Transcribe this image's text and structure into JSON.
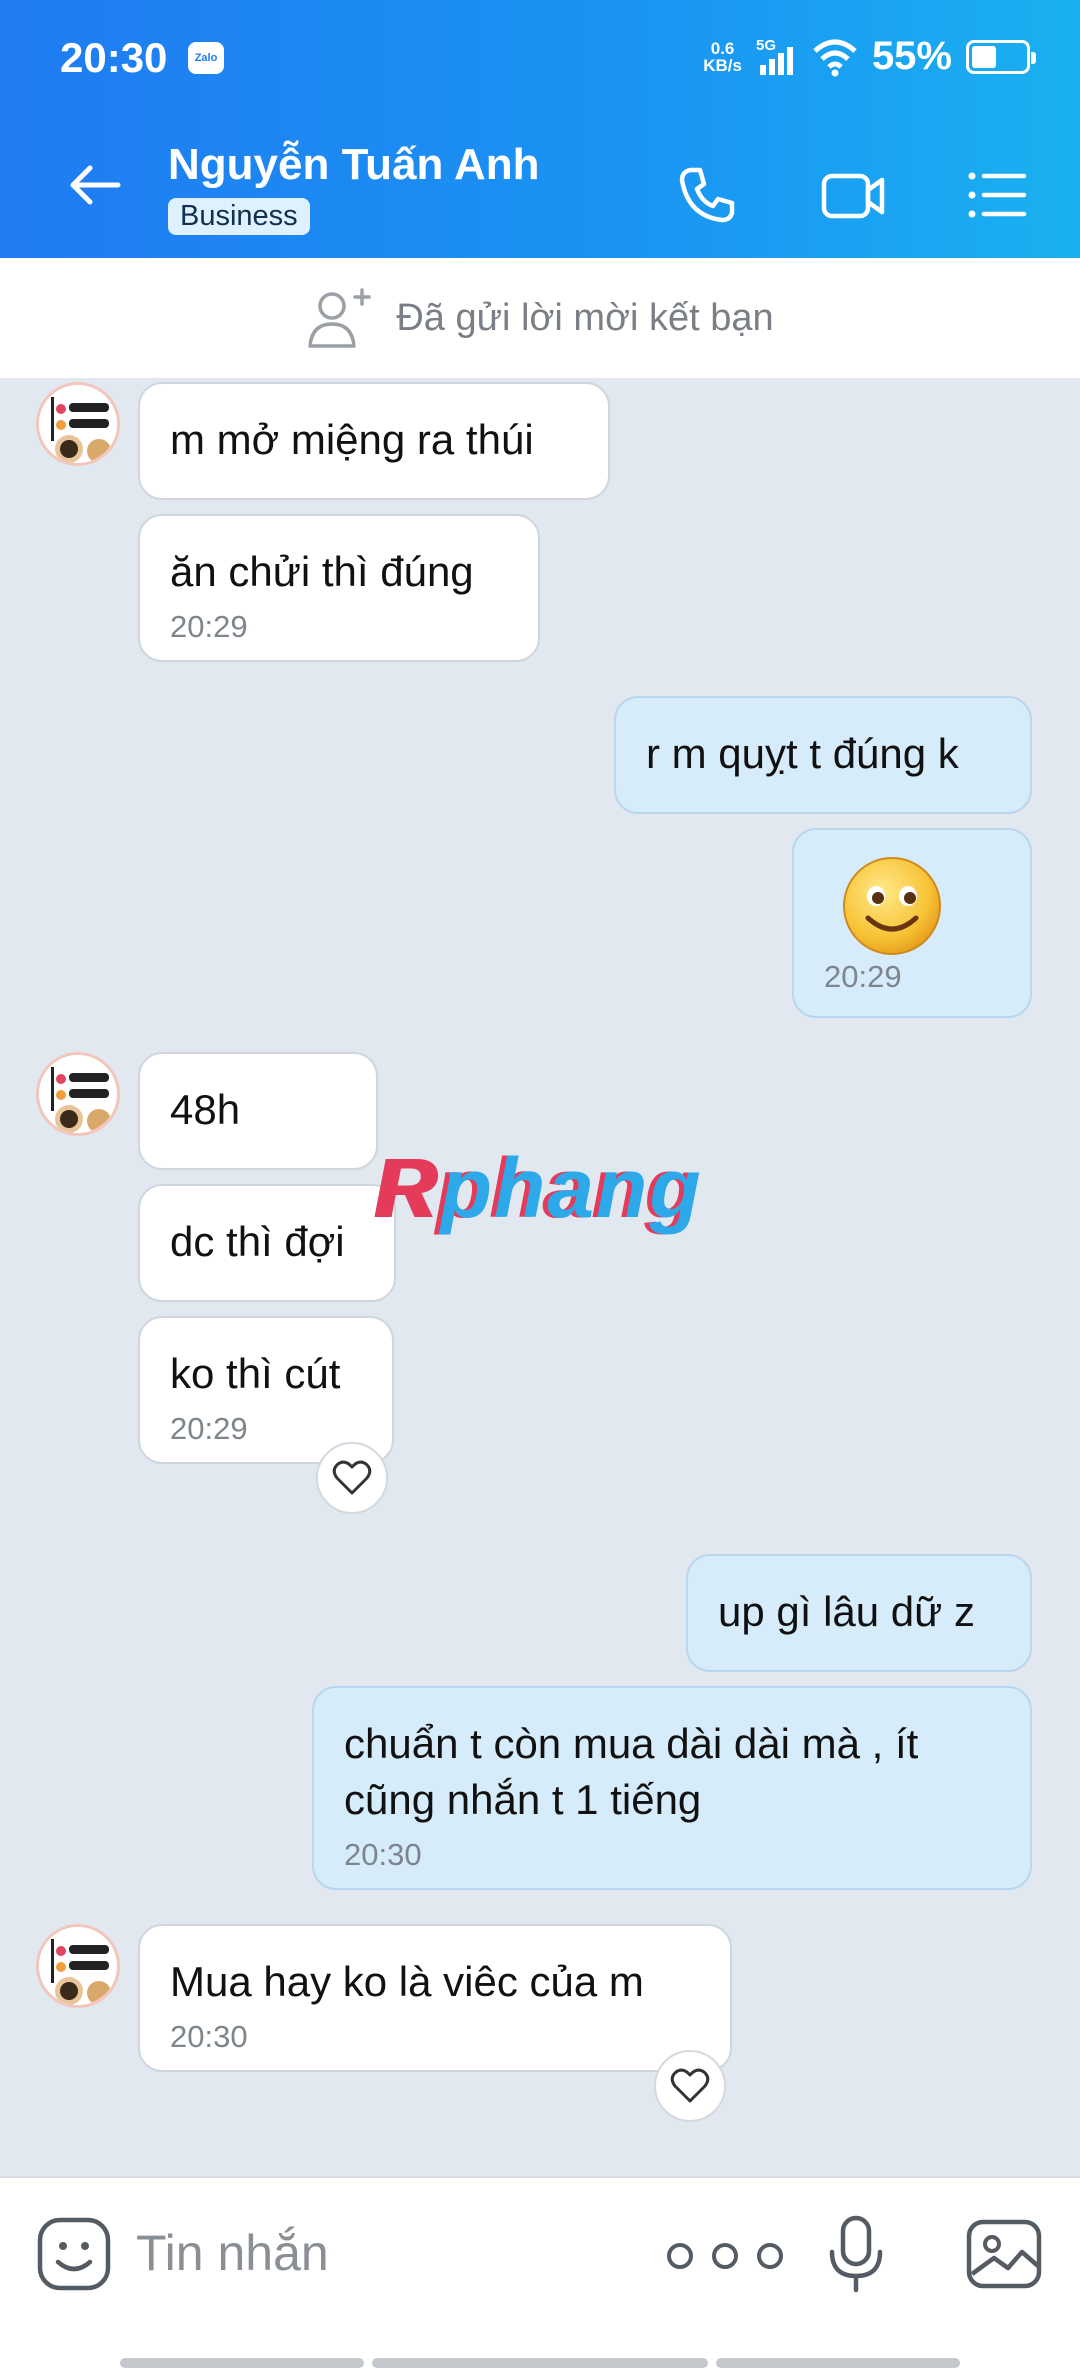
{
  "status": {
    "time": "20:30",
    "zalo": "Zalo",
    "speed_top": "0.6",
    "speed_unit": "KB/s",
    "network": "5G",
    "battery": "55%"
  },
  "header": {
    "name": "Nguyễn Tuấn Anh",
    "badge": "Business"
  },
  "friend_request": {
    "text": "Đã gửi lời mời kết bạn"
  },
  "messages": [
    {
      "text": "m mở miệng ra thúi"
    },
    {
      "text": "ăn chửi thì đúng",
      "time": "20:29"
    },
    {
      "text": "r m quỵt t đúng k"
    },
    {
      "time": "20:29"
    },
    {
      "text": "48h"
    },
    {
      "text": "dc thì đợi"
    },
    {
      "text": "ko thì cút",
      "time": "20:29"
    },
    {
      "text": "up gì lâu dữ z"
    },
    {
      "text": "chuẩn t còn mua dài dài mà , ít cũng nhắn t 1 tiếng",
      "time": "20:30"
    },
    {
      "text": "Mua hay ko là viêc của m",
      "time": "20:30"
    }
  ],
  "watermark": {
    "a": "R",
    "b": "phang"
  },
  "input": {
    "placeholder": "Tin nhắn"
  }
}
